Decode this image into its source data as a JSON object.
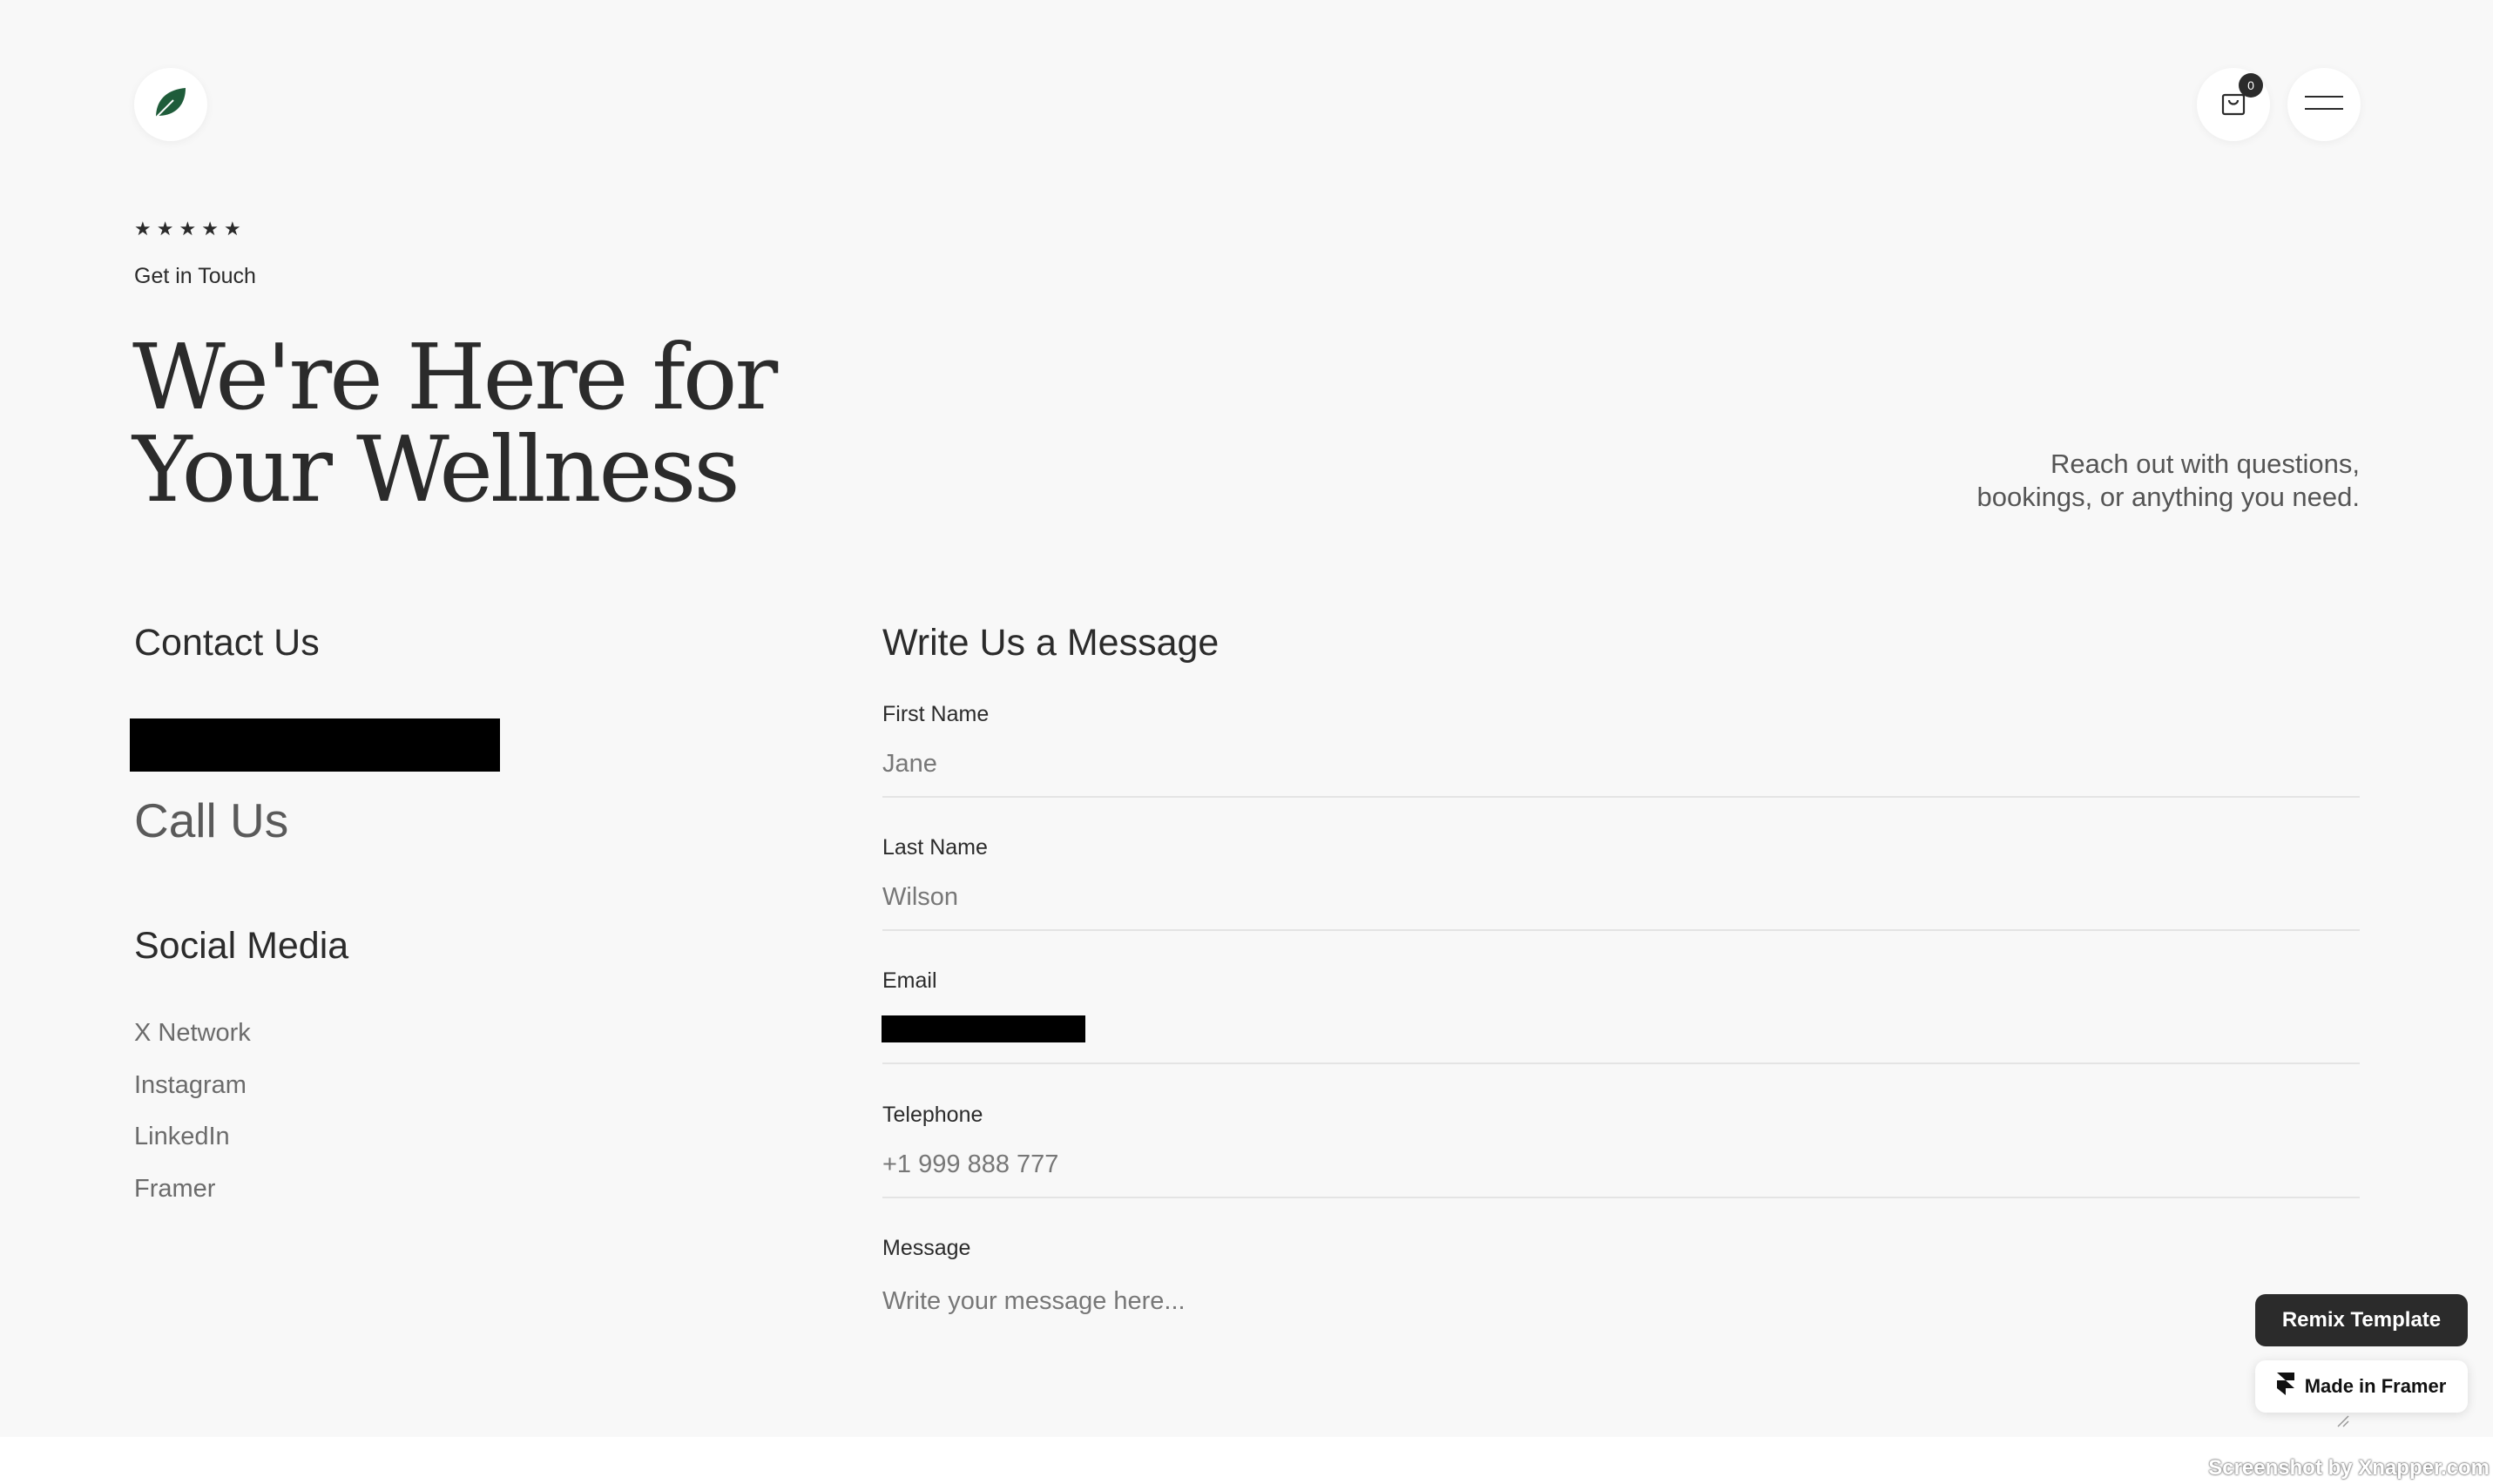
{
  "header": {
    "logo_icon": "leaf-icon",
    "cart_icon": "shopping-bag-icon",
    "cart_count": "0",
    "menu_icon": "hamburger-menu-icon",
    "accent_color": "#1f5c3a"
  },
  "hero": {
    "stars": [
      "★",
      "★",
      "★",
      "★",
      "★"
    ],
    "eyebrow": "Get in Touch",
    "title_line1": "We're Here for",
    "title_line2": "Your Wellness",
    "subtitle_line1": "Reach out with questions,",
    "subtitle_line2": "bookings, or anything you need."
  },
  "contact": {
    "heading": "Contact Us",
    "call_us": "Call Us",
    "social_heading": "Social Media",
    "social_links": [
      "X Network",
      "Instagram",
      "LinkedIn",
      "Framer"
    ]
  },
  "form": {
    "heading": "Write Us a Message",
    "fields": [
      {
        "label": "First Name",
        "placeholder": "Jane"
      },
      {
        "label": "Last Name",
        "placeholder": "Wilson"
      },
      {
        "label": "Email",
        "placeholder": ""
      },
      {
        "label": "Telephone",
        "placeholder": "+1 999 888 777"
      },
      {
        "label": "Message",
        "placeholder": "Write your message here..."
      }
    ]
  },
  "framer": {
    "remix_label": "Remix Template",
    "made_in_label": "Made in Framer"
  },
  "watermark": "Screenshot by Xnapper.com"
}
